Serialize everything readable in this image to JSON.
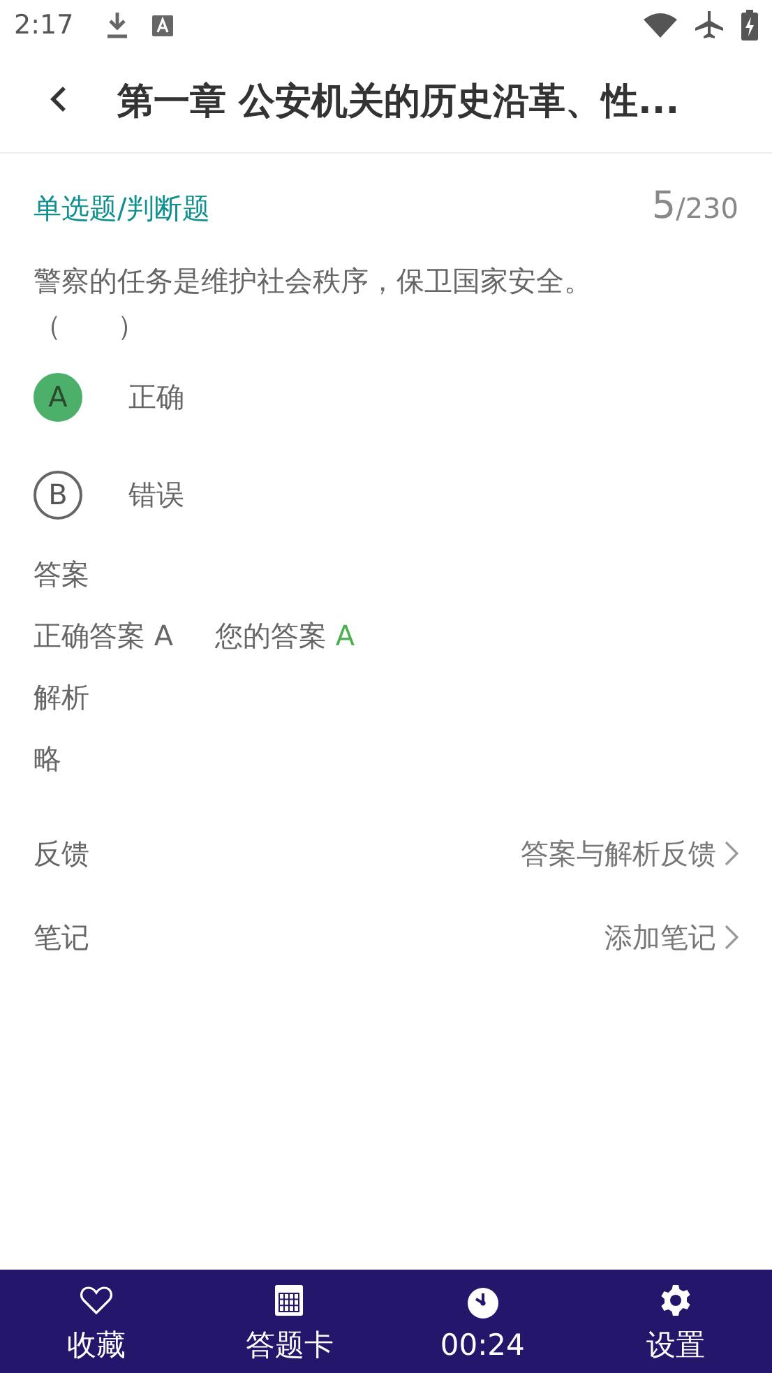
{
  "status_bar": {
    "time": "2:17"
  },
  "header": {
    "title": "第一章 公安机关的历史沿革、性..."
  },
  "question": {
    "type_label": "单选题/判断题",
    "current": "5",
    "total": "/230",
    "text": "警察的任务是维护社会秩序，保卫国家安全。",
    "blank": "（　　）"
  },
  "options": [
    {
      "letter": "A",
      "text": "正确",
      "selected": true
    },
    {
      "letter": "B",
      "text": "错误",
      "selected": false
    }
  ],
  "answer": {
    "heading": "答案",
    "correct_label": "正确答案 A",
    "yours_label": "您的答案",
    "yours_value": "A",
    "yours_correct": true
  },
  "analysis": {
    "heading": "解析",
    "text": "略"
  },
  "links": [
    {
      "label": "反馈",
      "action": "答案与解析反馈"
    },
    {
      "label": "笔记",
      "action": "添加笔记"
    }
  ],
  "bottom_nav": [
    {
      "kind": "heart",
      "label": "收藏"
    },
    {
      "kind": "grid",
      "label": "答题卡"
    },
    {
      "kind": "clock",
      "label": "00:24"
    },
    {
      "kind": "gear",
      "label": "设置"
    }
  ]
}
